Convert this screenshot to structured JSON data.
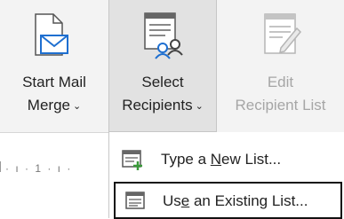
{
  "ribbon": {
    "start_mail_merge": {
      "line1": "Start Mail",
      "line2": "Merge",
      "icon": "start-mail-merge-icon"
    },
    "select_recipients": {
      "line1": "Select",
      "line2": "Recipients",
      "icon": "select-recipients-icon"
    },
    "edit_recipient_list": {
      "line1": "Edit",
      "line2": "Recipient List",
      "icon": "edit-recipient-list-icon",
      "disabled": true
    },
    "dropdown_chevron": "⌄"
  },
  "ruler": {
    "marks": "· ı · 1 · ı ·"
  },
  "menu": {
    "items": [
      {
        "label_pre": "Type a ",
        "label_key": "N",
        "label_post": "ew List...",
        "icon": "new-list-icon"
      },
      {
        "label_pre": "Us",
        "label_key": "e",
        "label_post": " an Existing List...",
        "icon": "existing-list-icon"
      }
    ]
  },
  "colors": {
    "accent_blue": "#1e6fd0",
    "green": "#3a9a3a",
    "ribbon_bg": "#f3f3f3",
    "selected_bg": "#e2e2e2",
    "disabled_text": "#a6a6a6"
  }
}
